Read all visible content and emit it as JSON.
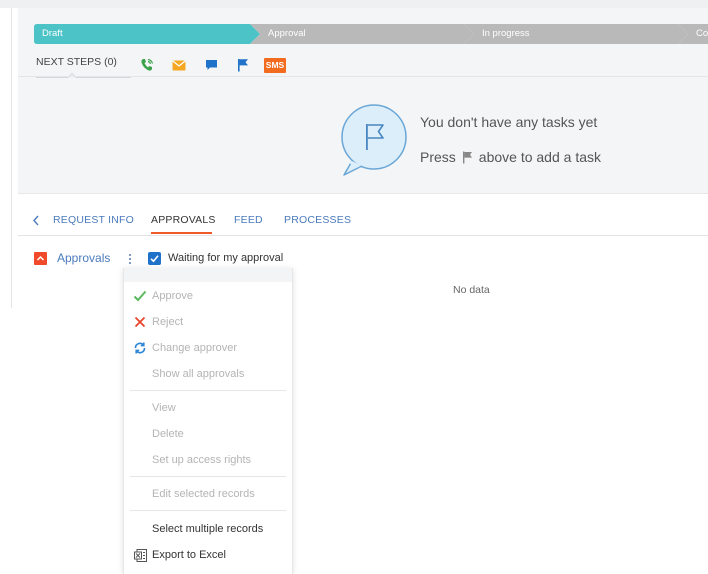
{
  "stages": [
    {
      "label": "Draft",
      "state": "active"
    },
    {
      "label": "Approval",
      "state": "inactive"
    },
    {
      "label": "In progress",
      "state": "inactive"
    },
    {
      "label": "Com",
      "state": "inactive"
    }
  ],
  "colors": {
    "active_stage": "#4cc3c7",
    "inactive_stage": "#b9b9b9",
    "accent": "#f05a28",
    "link": "#4a7bbd",
    "checkbox": "#1f72c9"
  },
  "next_steps": {
    "label": "NEXT STEPS (0)",
    "actions": [
      {
        "icon": "phone-icon",
        "color": "#3aa24a"
      },
      {
        "icon": "envelope-icon",
        "color": "#f5a623"
      },
      {
        "icon": "chat-icon",
        "color": "#1f72c9"
      },
      {
        "icon": "flag-icon",
        "color": "#1f72c9"
      },
      {
        "icon": "sms-icon",
        "label": "SMS",
        "color": "#f26b1f"
      }
    ]
  },
  "empty_tasks": {
    "line1": "You don't have any tasks yet",
    "line2_before": "Press",
    "line2_after": "above to add a task"
  },
  "tabs": [
    {
      "label": "REQUEST INFO",
      "active": false
    },
    {
      "label": "APPROVALS",
      "active": true
    },
    {
      "label": "FEED",
      "active": false
    },
    {
      "label": "PROCESSES",
      "active": false
    }
  ],
  "approvals": {
    "title": "Approvals",
    "filter_label": "Waiting for my approval",
    "filter_checked": true,
    "no_data": "No data"
  },
  "menu": {
    "items": [
      {
        "label": "Approve",
        "icon": "checkmark-icon",
        "enabled": false
      },
      {
        "label": "Reject",
        "icon": "x-icon",
        "enabled": false
      },
      {
        "label": "Change approver",
        "icon": "refresh-icon",
        "enabled": false
      },
      {
        "label": "Show all approvals",
        "icon": "",
        "enabled": false
      },
      {
        "label": "View",
        "icon": "",
        "enabled": false
      },
      {
        "label": "Delete",
        "icon": "",
        "enabled": false
      },
      {
        "label": "Set up access rights",
        "icon": "",
        "enabled": false
      },
      {
        "label": "Edit selected records",
        "icon": "",
        "enabled": false
      },
      {
        "label": "Select multiple records",
        "icon": "",
        "enabled": true
      },
      {
        "label": "Export to Excel",
        "icon": "excel-icon",
        "enabled": true
      }
    ]
  }
}
